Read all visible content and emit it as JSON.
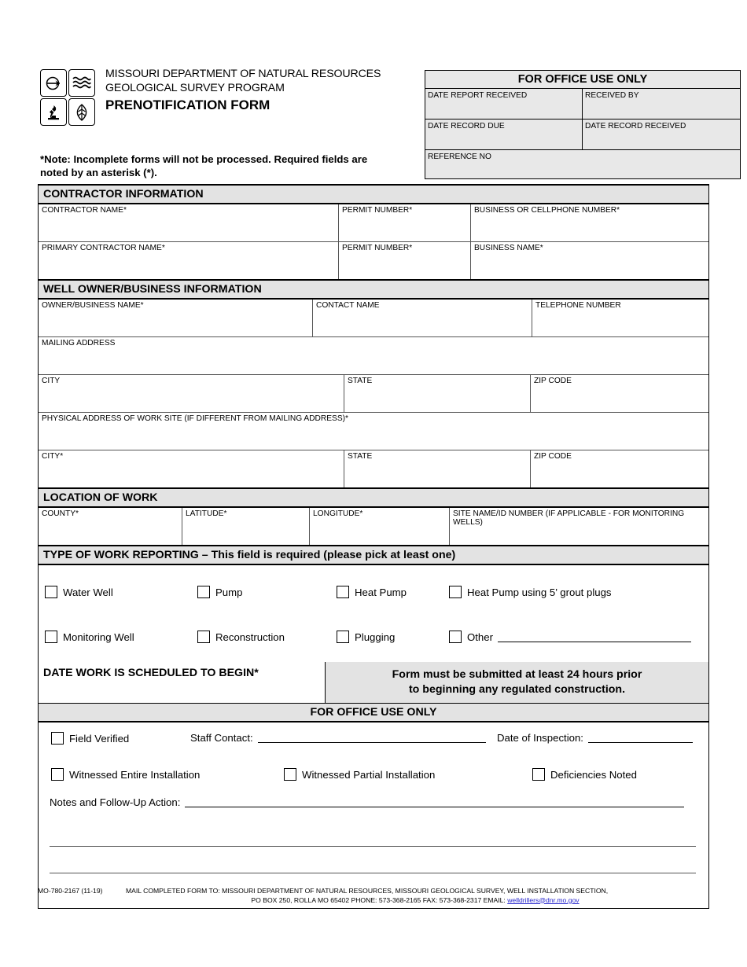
{
  "header": {
    "agency_line1": "MISSOURI DEPARTMENT OF NATURAL RESOURCES",
    "agency_line2": "GEOLOGICAL SURVEY PROGRAM",
    "form_title": "PRENOTIFICATION FORM",
    "note": "*Note: Incomplete forms will not be processed. Required fields are noted by an asterisk (*).",
    "logo_icons": [
      "circle-arrow-icon",
      "water-waves-icon",
      "microscope-icon",
      "leaf-icon"
    ]
  },
  "office_box_top": {
    "title": "FOR OFFICE USE ONLY",
    "fields": [
      "DATE REPORT RECEIVED",
      "RECEIVED BY",
      "DATE RECORD DUE",
      "DATE RECORD RECEIVED",
      "REFERENCE NO"
    ]
  },
  "contractor": {
    "band": "CONTRACTOR INFORMATION",
    "row1": [
      "CONTRACTOR NAME*",
      "PERMIT NUMBER*",
      "BUSINESS OR CELLPHONE NUMBER*"
    ],
    "row2": [
      "PRIMARY CONTRACTOR NAME*",
      "PERMIT NUMBER*",
      "BUSINESS NAME*"
    ]
  },
  "owner": {
    "band": "WELL OWNER/BUSINESS INFORMATION",
    "row1": [
      "OWNER/BUSINESS NAME*",
      "CONTACT NAME",
      "TELEPHONE NUMBER"
    ],
    "row2": [
      "MAILING ADDRESS"
    ],
    "row3": [
      "CITY",
      "STATE",
      "ZIP CODE"
    ],
    "row4": [
      "PHYSICAL ADDRESS OF WORK SITE (IF DIFFERENT FROM MAILING ADDRESS)*"
    ],
    "row5": [
      "CITY*",
      "STATE",
      "ZIP CODE"
    ]
  },
  "location": {
    "band": "LOCATION OF WORK",
    "row1": [
      "COUNTY*",
      "LATITUDE*",
      "LONGITUDE*",
      "SITE NAME/ID NUMBER (IF APPLICABLE - FOR MONITORING WELLS)"
    ]
  },
  "type_of_work": {
    "band": "TYPE OF WORK REPORTING – This field is required (please pick at least one)",
    "row1": [
      "Water Well",
      "Pump",
      "Heat Pump",
      "Heat Pump using 5’ grout plugs"
    ],
    "row2": [
      "Monitoring Well",
      "Reconstruction",
      "Plugging",
      "Other"
    ]
  },
  "date_work": {
    "label": "DATE WORK IS SCHEDULED TO BEGIN*",
    "notice_line1": "Form must be submitted at least 24 hours prior",
    "notice_line2": "to beginning any regulated construction."
  },
  "office_bottom": {
    "band": "FOR OFFICE USE ONLY",
    "field_verified": "Field Verified",
    "staff_contact": "Staff Contact:",
    "date_of_inspection": "Date of Inspection:",
    "witnessed_entire": "Witnessed Entire Installation",
    "witnessed_partial": "Witnessed Partial Installation",
    "deficiencies_noted": "Deficiencies Noted",
    "notes_label": "Notes and Follow-Up Action:"
  },
  "footer": {
    "form_code": "MO-780-2167 (11-19)",
    "line1": "MAIL COMPLETED FORM TO: MISSOURI DEPARTMENT OF NATURAL RESOURCES, MISSOURI GEOLOGICAL SURVEY, WELL INSTALLATION SECTION,",
    "line2_pre": "PO BOX 250, ROLLA MO 65402  PHONE: 573-368-2165  FAX: 573-368-2317 EMAIL:",
    "email": "welldrillers@dnr.mo.gov"
  },
  "colors": {
    "band_gray": "#e3e3e3",
    "office_gray": "#e8e8e8",
    "rule": "#000000",
    "link": "#2222cc"
  }
}
